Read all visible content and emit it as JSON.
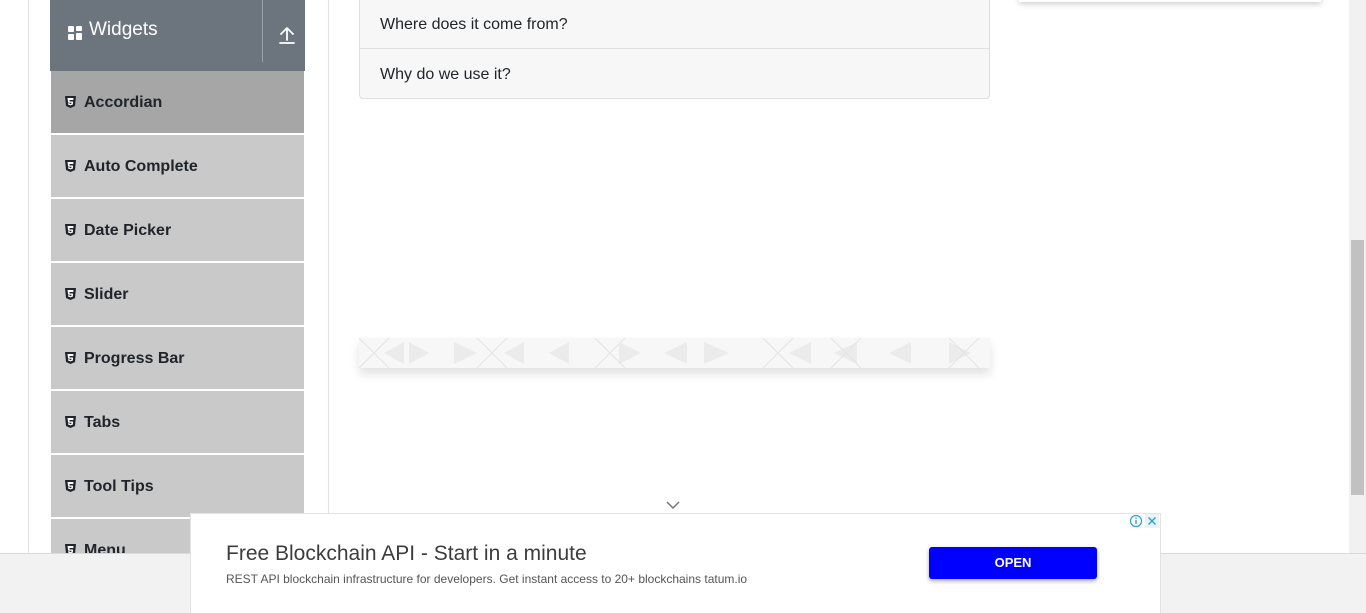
{
  "sidebar": {
    "group": {
      "title": "Widgets",
      "icon": "grid-icon",
      "toggle_icon": "upload-arrow-icon"
    },
    "items": [
      {
        "label": "Accordian",
        "icon": "html5-icon",
        "active": true
      },
      {
        "label": "Auto Complete",
        "icon": "html5-icon",
        "active": false
      },
      {
        "label": "Date Picker",
        "icon": "html5-icon",
        "active": false
      },
      {
        "label": "Slider",
        "icon": "html5-icon",
        "active": false
      },
      {
        "label": "Progress Bar",
        "icon": "html5-icon",
        "active": false
      },
      {
        "label": "Tabs",
        "icon": "html5-icon",
        "active": false
      },
      {
        "label": "Tool Tips",
        "icon": "html5-icon",
        "active": false
      },
      {
        "label": "Menu",
        "icon": "html5-icon",
        "active": false
      }
    ]
  },
  "accordion": {
    "sections": [
      {
        "title": "Where does it come from?"
      },
      {
        "title": "Why do we use it?"
      }
    ]
  },
  "ad": {
    "headline": "Free Blockchain API - Start in a minute",
    "body": "REST API blockchain infrastructure for developers. Get instant access to 20+ blockchains tatum.io",
    "button_label": "OPEN",
    "button_color": "#0000ff"
  },
  "colors": {
    "group_header": "#6c757d",
    "menu_item": "#c9c9c9",
    "menu_item_active": "#a6a6a6",
    "accordion_bg": "#f7f7f7"
  }
}
